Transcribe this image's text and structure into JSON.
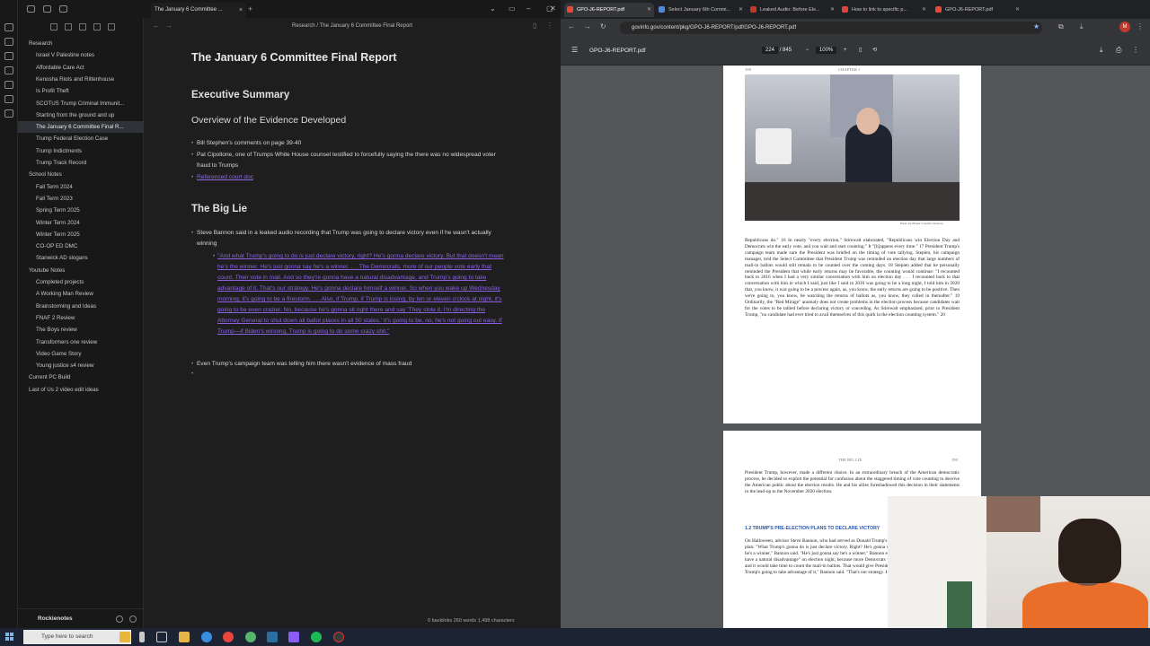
{
  "obsidian": {
    "tab_title": "The January 6 Committee ...",
    "breadcrumb_parent": "Research",
    "breadcrumb_sep": "/",
    "breadcrumb_current": "The January 6 Committee Final Report",
    "tree": [
      {
        "label": "Research",
        "level": 0,
        "caret": "v"
      },
      {
        "label": "Israel V Palestine notes",
        "level": 1,
        "caret": ">"
      },
      {
        "label": "Affordable Care Act",
        "level": 1
      },
      {
        "label": "Kenosha Riots and Rittenhouse",
        "level": 1
      },
      {
        "label": "Is Profit Theft",
        "level": 1
      },
      {
        "label": "SCOTUS Trump Criminal Immunit...",
        "level": 1
      },
      {
        "label": "Starting from the ground and up",
        "level": 1
      },
      {
        "label": "The January 6 Committee Final R...",
        "level": 1,
        "selected": true
      },
      {
        "label": "Trump Federal Election Case",
        "level": 1
      },
      {
        "label": "Trump Indictments",
        "level": 1
      },
      {
        "label": "Trump Track Record",
        "level": 1
      },
      {
        "label": "School Notes",
        "level": 0,
        "caret": "v"
      },
      {
        "label": "Fall Term 2024",
        "level": 1,
        "caret": ">"
      },
      {
        "label": "Fall Term 2023",
        "level": 1,
        "caret": ">"
      },
      {
        "label": "Spring Term 2025",
        "level": 1,
        "caret": ">"
      },
      {
        "label": "Winter Term 2024",
        "level": 1,
        "caret": ">"
      },
      {
        "label": "Winter Term 2025",
        "level": 1,
        "caret": ">"
      },
      {
        "label": "CO-OP ED DMC",
        "level": 1
      },
      {
        "label": "Stanwick AD slogans",
        "level": 1
      },
      {
        "label": "Youtube Notes",
        "level": 0,
        "caret": "v"
      },
      {
        "label": "Completed projects",
        "level": 1,
        "caret": ">"
      },
      {
        "label": "A Working Man Review",
        "level": 1
      },
      {
        "label": "Brainstorming and Ideas",
        "level": 1
      },
      {
        "label": "FNAF 2 Review",
        "level": 1
      },
      {
        "label": "The Boys review",
        "level": 1
      },
      {
        "label": "Transformers one review",
        "level": 1
      },
      {
        "label": "Video Game Story",
        "level": 1
      },
      {
        "label": "Young justice s4 review",
        "level": 1
      },
      {
        "label": "Current PC Build",
        "level": 0
      },
      {
        "label": "Last of Us 2 video edit ideas",
        "level": 0
      }
    ],
    "vault_name": "Rockienotes",
    "note": {
      "title": "The January 6 Committee Final Report",
      "h_summary": "Executive Summary",
      "h_overview": "Overview of the Evidence Developed",
      "b1": "Bill Stephen's comments on page 39-40",
      "b2": "Pat Cipollone, one of Trumps White House counsel testified to forcefully saying the there was no widespread voter fraud to Trumps",
      "b3": "Referenced court doc",
      "h_biglie": "The Big Lie",
      "b4": "Steve Bannon said in a leaked audio recording that Trump was going to declare victory even if he wasn't actually winning",
      "quote": "\"And what Trump's going to do is just declare victory, right? He's gonna declare victory. But that doesn't mean he's the winner. He's just gonna say he's a winner. . . .The Democrats, more of our people vote early that count. Their vote in mail. And so they're gonna have a natural disadvantage, and Trump's going to take advantage of it. That's our strategy. He's gonna declare himself a winner. So when you wake up Wednesday morning, it's going to be a firestorm. . . .Also, if Trump, if Trump is losing, by ten or eleven o'clock at night, it's going to be even crazier. No, because he's gonna sit right there and say 'They stole it. I'm directing the Attorney General to shut down all ballot places in all 50 states.' It's going to be, no, he's not going out easy. If Trump—if Biden's winning, Trump is going to do some crazy shit.\"",
      "b5": "Even Trump's campaign team was telling him there wasn't evidence of mass fraud"
    },
    "status": "0 backlinks   260 words   1,498 characters"
  },
  "chrome": {
    "tabs": [
      {
        "label": "GPO-J6-REPORT.pdf",
        "color": "#e34b3b",
        "active": true
      },
      {
        "label": "Select January 6th Commi...",
        "color": "#4e8be0"
      },
      {
        "label": "Leaked Audio: Before Ele...",
        "color": "#c0392b"
      },
      {
        "label": "How to link to specific p...",
        "color": "#e0453b"
      },
      {
        "label": "GPO-J6-REPORT.pdf",
        "color": "#e34b3b"
      }
    ],
    "url": "govinfo.gov/content/pkg/GPO-J6-REPORT/pdf/GPO-J6-REPORT.pdf",
    "profile": "M"
  },
  "pdf": {
    "title": "GPO-J6-REPORT.pdf",
    "page_current": "224",
    "page_total": "/ 845",
    "zoom": "100%",
    "page1_num": "198",
    "page1_chapter": "CHAPTER 1",
    "photo_caption": "Photo by House Creative Services",
    "page1_text": "Republicans do.\" 16 In nearly \"every election,\" Stirewalt elaborated, \"Republicans win Election Day and Democrats win the early vote, and you wait and start counting.\" It \"[h]appens every time.\" 17 President Trump's campaign team made sure the President was briefed on the timing of vote tallying. Stepien, his campaign manager, told the Select Committee that President Trump was reminded on election day that large numbers of mail-in ballots would still remain to be counted over the coming days. 18 Stepien added that he personally reminded the President that while early returns may be favorable, the counting would continue: \"I recounted back to 2016 when I had a very similar conversation with him on election day . . . I recounted back to that conversation with him in which I said, just like I said in 2016 was going to be a long night, I told him in 2020 that, you know, it was going to be a process again, as, you know, the early returns are going to be positive. Then we're going to, you know, be watching the returns of ballots as, you know, they rolled in thereafter.\" 19 Ordinarily, the \"Red Mirage\" anomaly does not create problems in the election process because candidates wait for the votes to be tallied before declaring victory or conceding. As Stirewalt emphasized, prior to President Trump, \"no candidate had ever tried to avail themselves of this quirk in the election counting system.\" 20",
    "page2_head": "THE BIG LIE",
    "page2_num": "199",
    "page2_text1": "President Trump, however, made a different choice. In an extraordinary breach of the American democratic process, he decided to exploit the potential for confusion about the staggered timing of vote counting to deceive the American public about the election results. He and his allies foreshadowed this decision in their statements in the lead-up to the November 2020 election.",
    "page2_section": "1.2  TRUMP'S PRE-ELECTION PLANS TO DECLARE VICTORY",
    "page2_text2": "On Halloween, advisor Steve Bannon, who had served as Donald Trump's 2016 campaign manager, laid out the plan: \"What Trump's gonna do is just declare victory. Right? He's gonna declare victory. But that doesn't mean he's a winner,\" Bannon said. \"He's just gonna say he's a winner.\" Bannon explained that the Democrats \"[would] have a natural disadvantage\" on election night, because more Democrats would vote by mail than Republicans and it would take time to count the mail-in ballots. That would give President Trump the illusion of a lead. \"And Trump's going to take advantage of it,\" Bannon said. \"That's our strategy. He's gonna declare himself a winner.\""
  },
  "taskbar": {
    "search_placeholder": "Type here to search"
  }
}
